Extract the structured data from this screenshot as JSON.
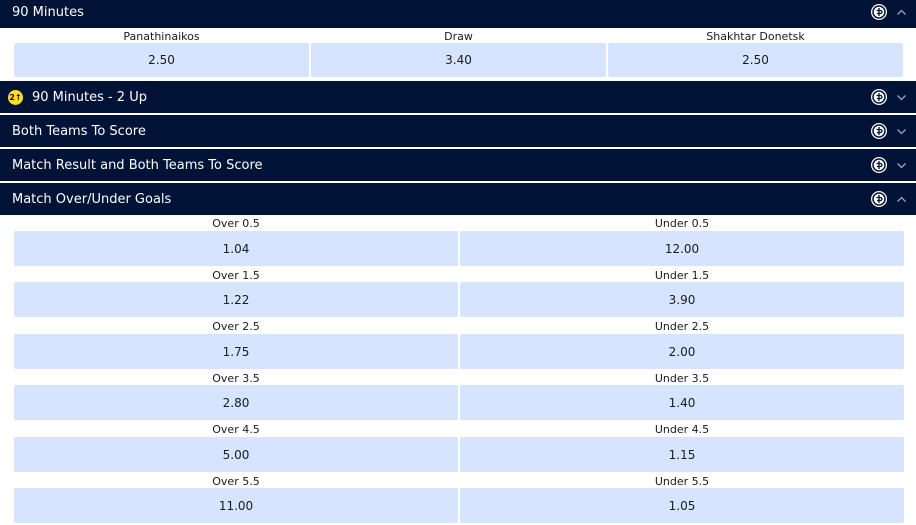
{
  "markets": {
    "m90": {
      "title": "90 Minutes"
    },
    "m2up": {
      "title": "90 Minutes - 2 Up",
      "badge": "2↑"
    },
    "btts": {
      "title": "Both Teams To Score"
    },
    "mrbtts": {
      "title": "Match Result and Both Teams To Score"
    },
    "ou": {
      "title": "Match Over/Under Goals"
    }
  },
  "result": {
    "selections": [
      {
        "label": "Panathinaikos",
        "odds": "2.50"
      },
      {
        "label": "Draw",
        "odds": "3.40"
      },
      {
        "label": "Shakhtar Donetsk",
        "odds": "2.50"
      }
    ]
  },
  "overunder": {
    "rows": [
      {
        "over_label": "Over 0.5",
        "over_odds": "1.04",
        "under_label": "Under 0.5",
        "under_odds": "12.00"
      },
      {
        "over_label": "Over 1.5",
        "over_odds": "1.22",
        "under_label": "Under 1.5",
        "under_odds": "3.90"
      },
      {
        "over_label": "Over 2.5",
        "over_odds": "1.75",
        "under_label": "Under 2.5",
        "under_odds": "2.00"
      },
      {
        "over_label": "Over 3.5",
        "over_odds": "2.80",
        "under_label": "Under 3.5",
        "under_odds": "1.40"
      },
      {
        "over_label": "Over 4.5",
        "over_odds": "5.00",
        "under_label": "Under 4.5",
        "under_odds": "1.15"
      },
      {
        "over_label": "Over 5.5",
        "over_odds": "11.00",
        "under_label": "Under 5.5",
        "under_odds": "1.05"
      }
    ]
  },
  "icons": {
    "cash_out": "cash-out-icon",
    "expand": "chevron-down-icon",
    "collapse": "chevron-up-icon"
  },
  "colors": {
    "header_bg": "#001236",
    "odds_bg": "#d6e4ff",
    "badge": "#ffdf1b"
  }
}
